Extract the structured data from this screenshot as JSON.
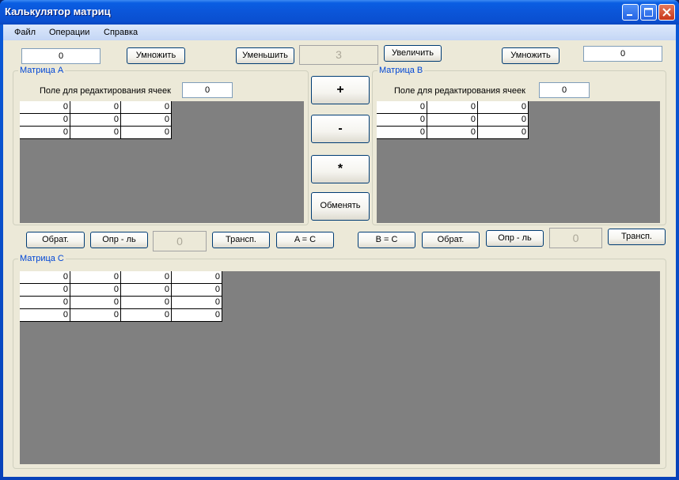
{
  "window": {
    "title": "Калькулятор матриц"
  },
  "menu": {
    "items": [
      "Файл",
      "Операции",
      "Справка"
    ]
  },
  "top_row": {
    "left_factor": "0",
    "left_multiply": "Умножить",
    "decrease": "Уменьшить",
    "size_value": "3",
    "increase": "Увеличить",
    "right_multiply": "Умножить",
    "right_factor": "0"
  },
  "matrix_a": {
    "label": "Матрица A",
    "edit_label": "Поле для редактирования ячеек",
    "edit_value": "0",
    "cells": [
      [
        "0",
        "0",
        "0"
      ],
      [
        "0",
        "0",
        "0"
      ],
      [
        "0",
        "0",
        "0"
      ]
    ]
  },
  "matrix_b": {
    "label": "Матрица B",
    "edit_label": "Поле для редактирования ячеек",
    "edit_value": "0",
    "cells": [
      [
        "0",
        "0",
        "0"
      ],
      [
        "0",
        "0",
        "0"
      ],
      [
        "0",
        "0",
        "0"
      ]
    ]
  },
  "ops": {
    "add": "+",
    "subtract": "-",
    "multiply": "*",
    "swap": "Обменять"
  },
  "row_a": {
    "inverse": "Обрат.",
    "determinant": "Опр - ль",
    "det_value": "0",
    "transpose": "Трансп.",
    "copy": "A = C"
  },
  "row_b": {
    "copy": "B = C",
    "inverse": "Обрат.",
    "determinant": "Опр - ль",
    "det_value": "0",
    "transpose": "Трансп."
  },
  "matrix_c": {
    "label": "Матрица C",
    "cells": [
      [
        "0",
        "0",
        "0",
        "0"
      ],
      [
        "0",
        "0",
        "0",
        "0"
      ],
      [
        "0",
        "0",
        "0",
        "0"
      ],
      [
        "0",
        "0",
        "0",
        "0"
      ]
    ]
  },
  "colors": {
    "title_bar": "#0a5ee3",
    "client": "#ece9d8",
    "group_label": "#0046d5",
    "grid_bg": "#808080"
  }
}
